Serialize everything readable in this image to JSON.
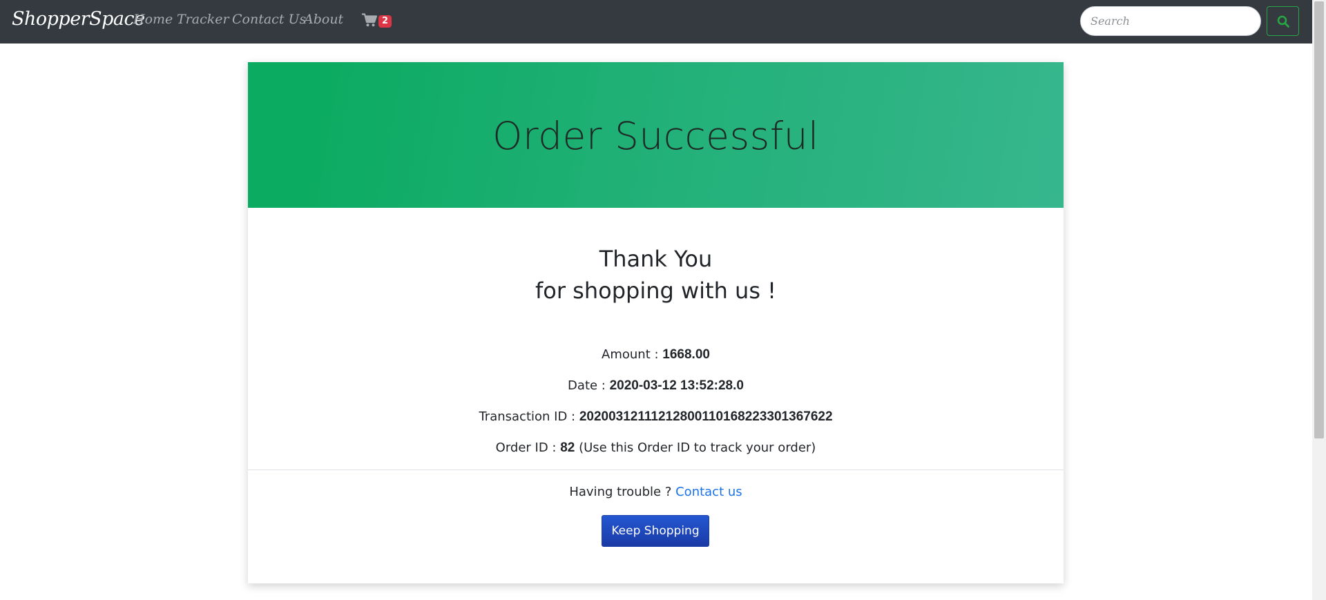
{
  "navbar": {
    "brand": "ShopperSpace",
    "links": [
      "Home",
      "Tracker",
      "Contact Us",
      "About"
    ],
    "cart_count": "2",
    "search_placeholder": "Search",
    "search_button_icon": "search-icon",
    "cart_icon": "cart-icon"
  },
  "colors": {
    "navbar_bg": "#343a40",
    "header_gradient_start": "#0cab62",
    "header_gradient_end": "#37b68d",
    "badge": "#dc3545",
    "search_button_border": "#28a745",
    "link": "#1a73e8",
    "button": "#1f4bc0"
  },
  "header": {
    "title": "Order Successful"
  },
  "thanks": {
    "line1": "Thank You",
    "line2": "for shopping with us !"
  },
  "details": {
    "amount_label": "Amount : ",
    "amount_value": "1668.00",
    "date_label": "Date : ",
    "date_value": "2020-03-12 13:52:28.0",
    "transaction_label": "Transaction ID : ",
    "transaction_value": "20200312111212800110168223301367622",
    "order_label": "Order ID : ",
    "order_value": "82",
    "order_note": " (Use this Order ID to track your order)"
  },
  "footer": {
    "trouble_text": "Having trouble ? ",
    "contact_link": "Contact us",
    "keep_shopping": "Keep Shopping"
  }
}
